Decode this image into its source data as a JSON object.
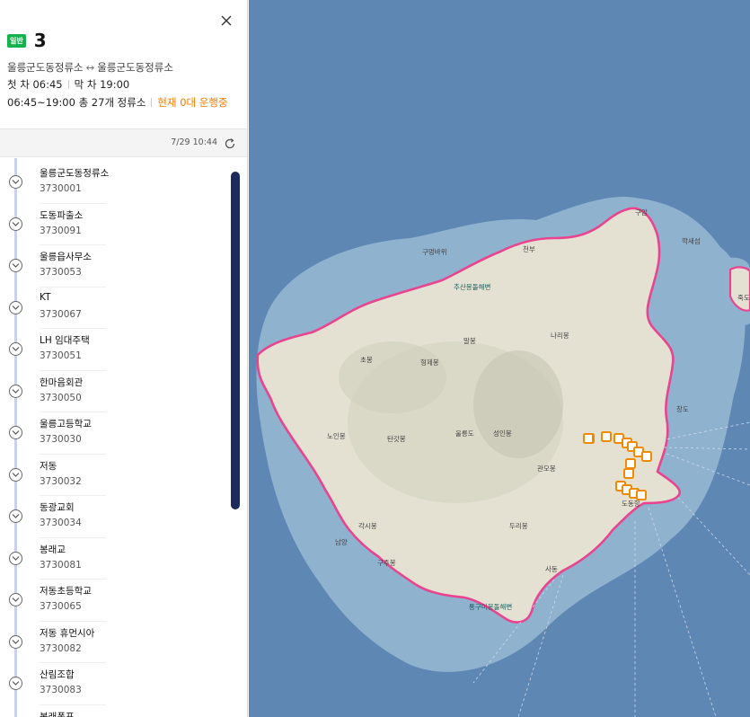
{
  "route": {
    "badge": "일반",
    "number": "3",
    "terminals_from": "울릉군도동정류소",
    "arrow": "↔",
    "terminals_to": "울릉군도동정류소",
    "first_label": "첫 차 06:45",
    "last_label": "막 차 19:00",
    "summary": "06:45~19:00 총 27개 정류소",
    "running_status": "현재 0대 운행중"
  },
  "refresh": {
    "time": "7/29 10:44"
  },
  "stops": [
    {
      "name": "울릉군도동정류소",
      "id": "3730001"
    },
    {
      "name": "도동파출소",
      "id": "3730091"
    },
    {
      "name": "울릉읍사무소",
      "id": "3730053"
    },
    {
      "name": "KT",
      "id": "3730067"
    },
    {
      "name": "LH 임대주택",
      "id": "3730051"
    },
    {
      "name": "한마음회관",
      "id": "3730050"
    },
    {
      "name": "울릉고등학교",
      "id": "3730030"
    },
    {
      "name": "저동",
      "id": "3730032"
    },
    {
      "name": "동광교회",
      "id": "3730034"
    },
    {
      "name": "봉래교",
      "id": "3730081"
    },
    {
      "name": "저동초등학교",
      "id": "3730065"
    },
    {
      "name": "저동 휴먼시아",
      "id": "3730082"
    },
    {
      "name": "산림조합",
      "id": "3730083"
    },
    {
      "name": "봉래폭포",
      "id": ""
    }
  ],
  "map": {
    "peaks": [
      "초봉",
      "형제봉",
      "말봉",
      "나리봉",
      "노인봉",
      "탄갓봉",
      "울릉도",
      "성인봉",
      "관모봉",
      "각시봉",
      "두리봉"
    ],
    "places": [
      "구멍바위",
      "천부",
      "추산몽돌해변",
      "구암",
      "깍새섬",
      "죽도",
      "창도",
      "도동항",
      "남양",
      "구주봉",
      "통구미몽돌해변",
      "사동"
    ],
    "colors": {
      "sea": "#5f87b4",
      "shallow": "#8fb2cf",
      "land": "#e4e1d2",
      "route": "#e8448f",
      "bus_stop": "#f08a00"
    }
  }
}
